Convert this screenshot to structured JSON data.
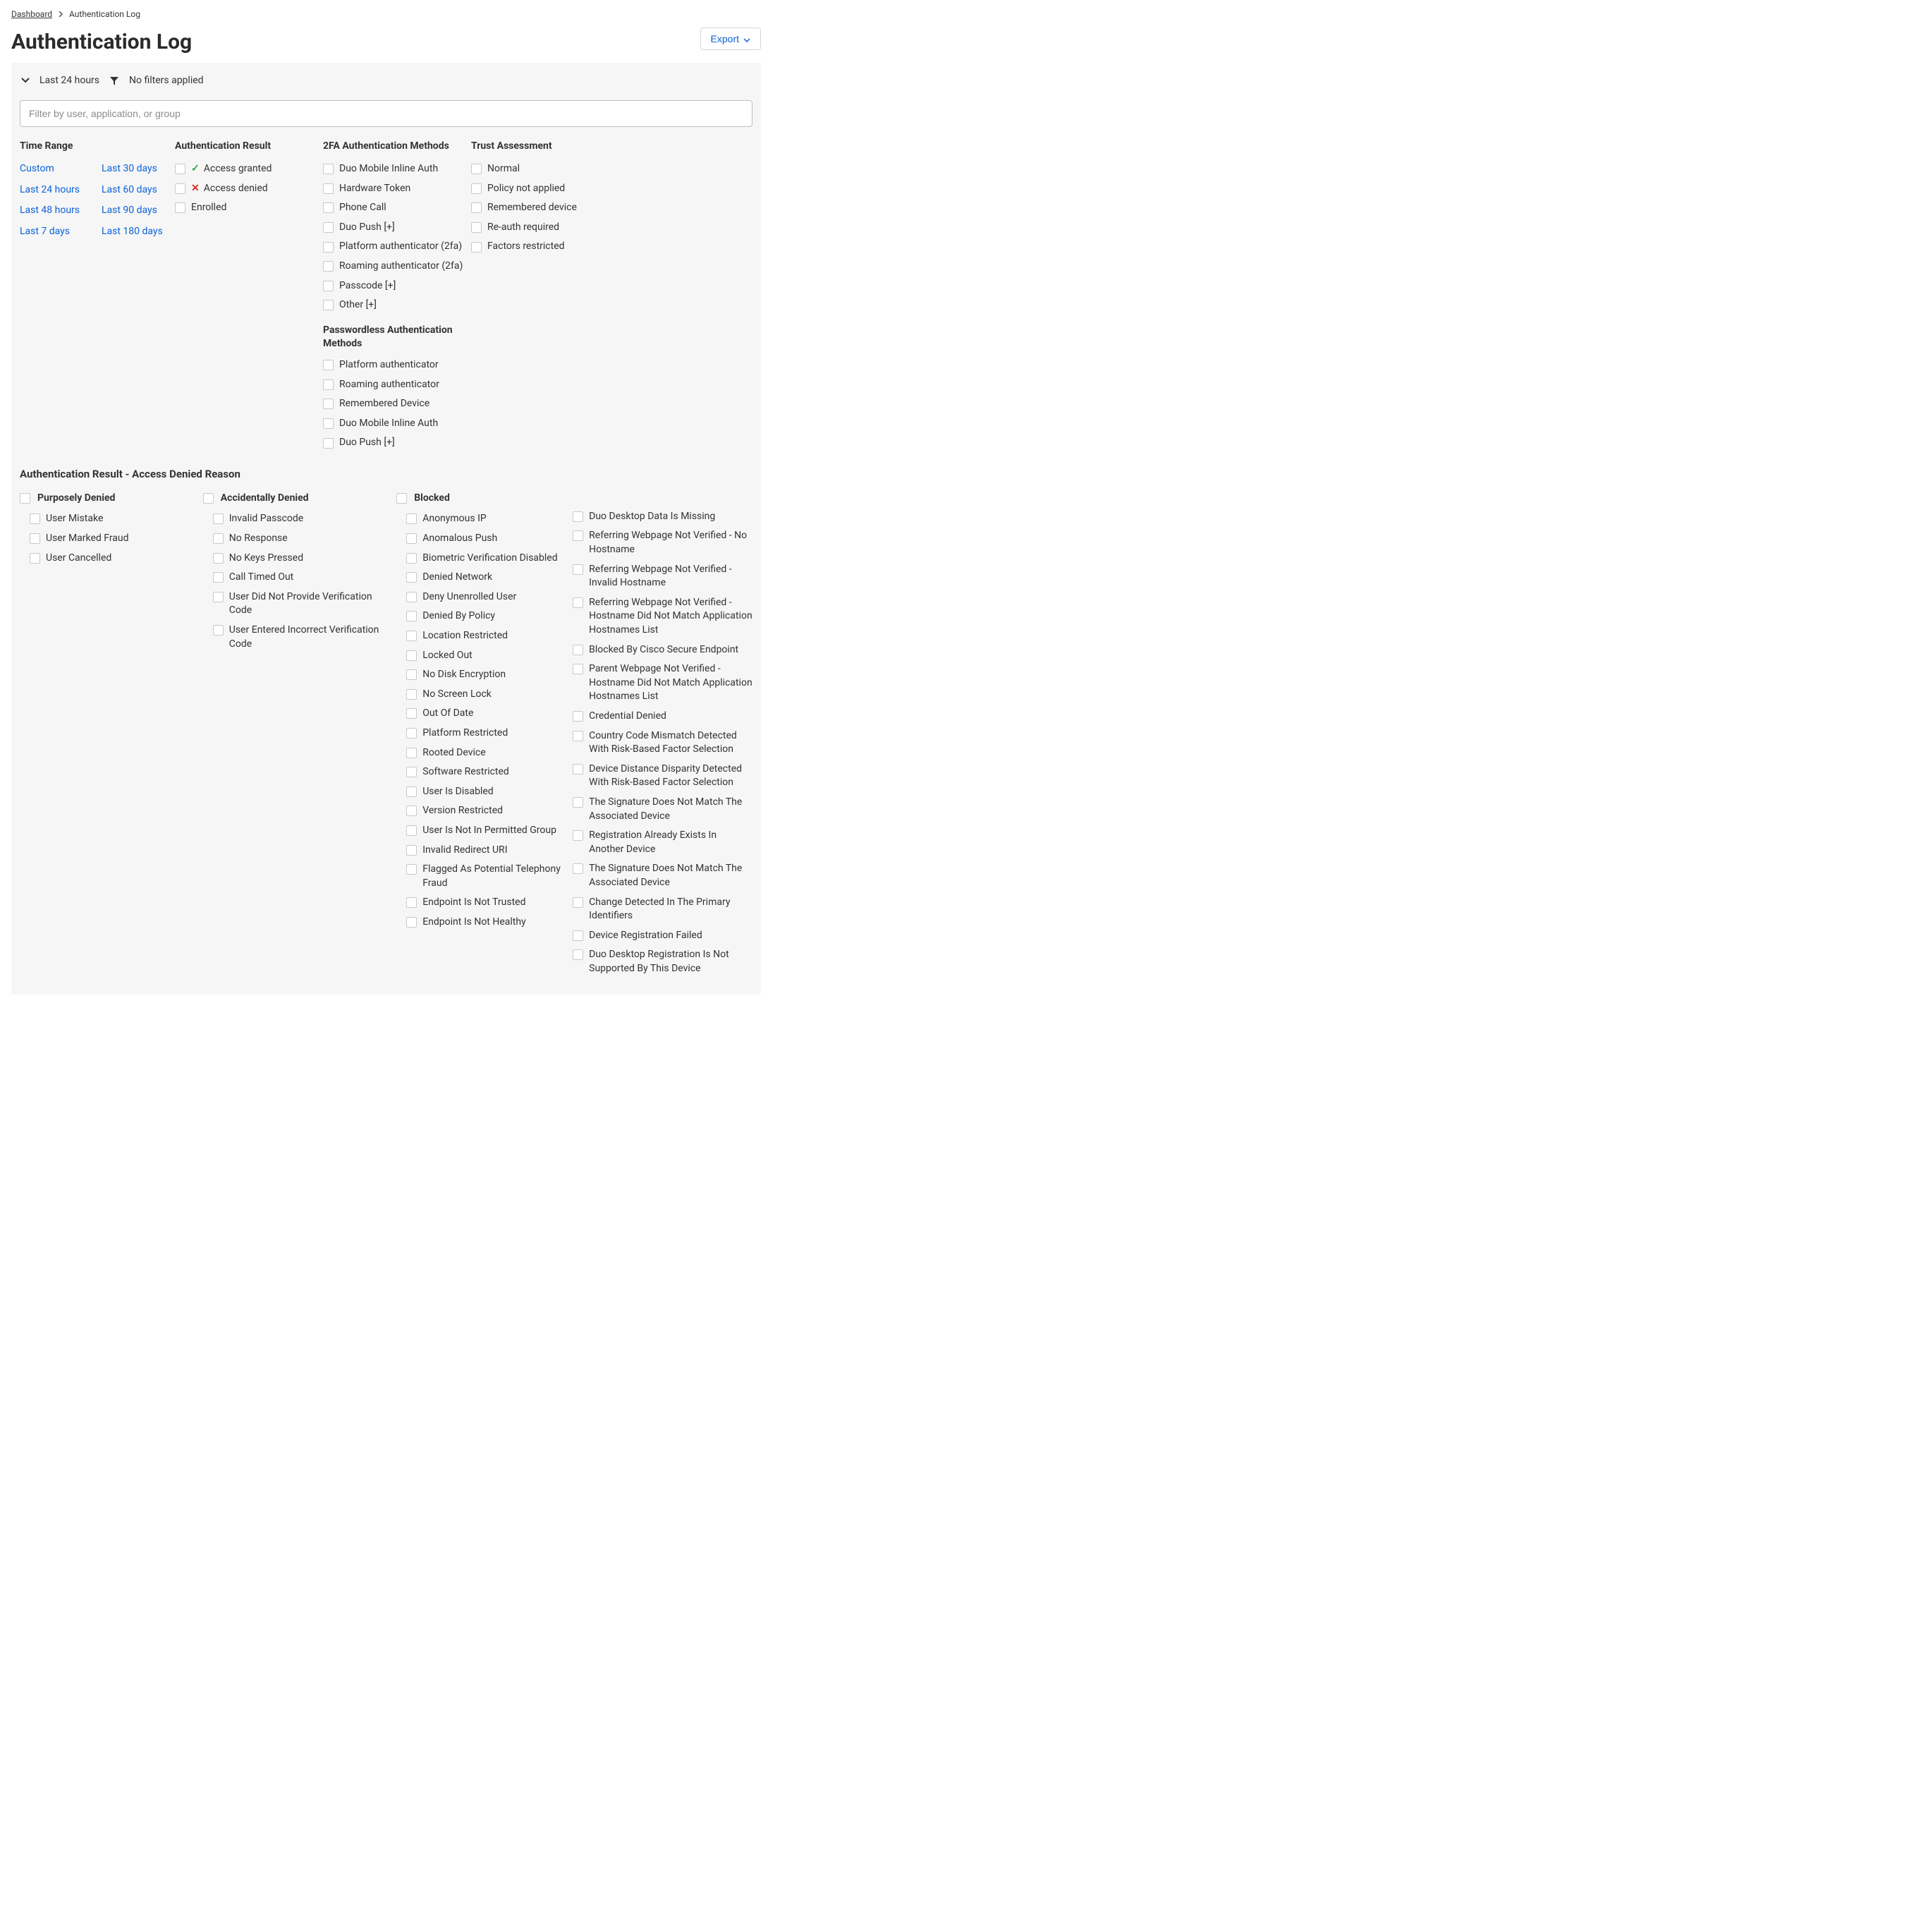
{
  "breadcrumb": {
    "dashboard": "Dashboard",
    "current": "Authentication Log"
  },
  "page_title": "Authentication Log",
  "export_label": "Export",
  "summary": {
    "timerange": "Last 24 hours",
    "filters": "No filters applied"
  },
  "search": {
    "placeholder": "Filter by user, application, or group"
  },
  "sections": {
    "time_range_title": "Time Range",
    "auth_result_title": "Authentication Result",
    "methods_title": "2FA Authentication Methods",
    "passwordless_title": "Passwordless Authentication Methods",
    "trust_title": "Trust Assessment",
    "denied_title": "Authentication Result - Access Denied Reason"
  },
  "time_ranges": {
    "left": [
      "Custom",
      "Last 24 hours",
      "Last 48 hours",
      "Last 7 days"
    ],
    "right": [
      "Last 30 days",
      "Last 60 days",
      "Last 90 days",
      "Last 180 days"
    ]
  },
  "auth_results": [
    {
      "label": "Access granted",
      "icon": "check"
    },
    {
      "label": "Access denied",
      "icon": "x"
    },
    {
      "label": "Enrolled",
      "icon": ""
    }
  ],
  "methods_2fa": [
    "Duo Mobile Inline Auth",
    "Hardware Token",
    "Phone Call",
    "Duo Push [+]",
    "Platform authenticator (2fa)",
    "Roaming authenticator (2fa)",
    "Passcode [+]",
    "Other [+]"
  ],
  "passwordless": [
    "Platform authenticator",
    "Roaming authenticator",
    "Remembered Device",
    "Duo Mobile Inline Auth",
    "Duo Push [+]"
  ],
  "trust": [
    "Normal",
    "Policy not applied",
    "Remembered device",
    "Re-auth required",
    "Factors restricted"
  ],
  "denied": {
    "purposely": {
      "label": "Purposely Denied",
      "items": [
        "User Mistake",
        "User Marked Fraud",
        "User Cancelled"
      ]
    },
    "accidental": {
      "label": "Accidentally Denied",
      "items": [
        "Invalid Passcode",
        "No Response",
        "No Keys Pressed",
        "Call Timed Out",
        "User Did Not Provide Verification Code",
        "User Entered Incorrect Verification Code"
      ]
    },
    "blocked": {
      "label": "Blocked",
      "col1": [
        "Anonymous IP",
        "Anomalous Push",
        "Biometric Verification Disabled",
        "Denied Network",
        "Deny Unenrolled User",
        "Denied By Policy",
        "Location Restricted",
        "Locked Out",
        "No Disk Encryption",
        "No Screen Lock",
        "Out Of Date",
        "Platform Restricted",
        "Rooted Device",
        "Software Restricted",
        "User Is Disabled",
        "Version Restricted",
        "User Is Not In Permitted Group",
        "Invalid Redirect URI",
        "Flagged As Potential Telephony Fraud",
        "Endpoint Is Not Trusted",
        "Endpoint Is Not Healthy"
      ],
      "col2": [
        "Duo Desktop Data Is Missing",
        "Referring Webpage Not Verified - No Hostname",
        "Referring Webpage Not Verified - Invalid Hostname",
        "Referring Webpage Not Verified - Hostname Did Not Match Application Hostnames List",
        "Blocked By Cisco Secure Endpoint",
        "Parent Webpage Not Verified - Hostname Did Not Match Application Hostnames List",
        "Credential Denied",
        "Country Code Mismatch Detected With Risk-Based Factor Selection",
        "Device Distance Disparity Detected With Risk-Based Factor Selection",
        "The Signature Does Not Match The Associated Device",
        "Registration Already Exists In Another Device",
        "The Signature Does Not Match The Associated Device",
        "Change Detected In The Primary Identifiers",
        "Device Registration Failed",
        "Duo Desktop Registration Is Not Supported By This Device"
      ]
    }
  }
}
